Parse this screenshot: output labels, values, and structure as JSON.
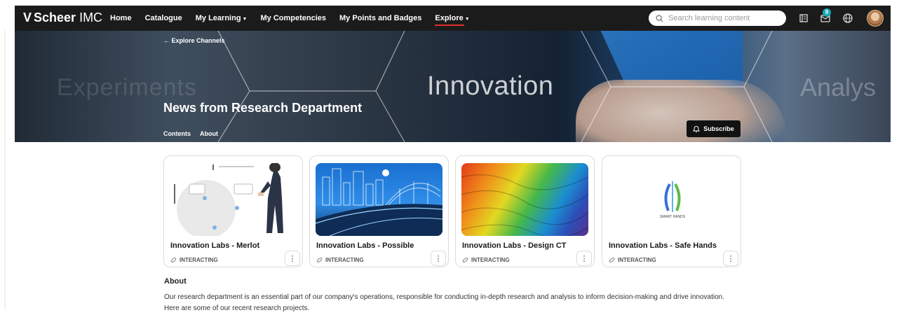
{
  "app": {
    "logo_mark": "V",
    "brand_bold": "Scheer",
    "brand_rest": " IMC"
  },
  "nav": [
    {
      "label": "Home",
      "has_caret": false,
      "active": false
    },
    {
      "label": "Catalogue",
      "has_caret": false,
      "active": false
    },
    {
      "label": "My Learning",
      "has_caret": true,
      "active": false
    },
    {
      "label": "My Competencies",
      "has_caret": false,
      "active": false
    },
    {
      "label": "My Points and Badges",
      "has_caret": false,
      "active": false
    },
    {
      "label": "Explore",
      "has_caret": true,
      "active": true
    }
  ],
  "search": {
    "placeholder": "Search learning content",
    "value": ""
  },
  "toolbar": {
    "message_count": "9",
    "icons": [
      "bookmark-icon",
      "mail-icon",
      "globe-icon",
      "avatar"
    ]
  },
  "banner": {
    "back_link": "← Explore Channels",
    "bg_word_left": "Experiments",
    "bg_word_center": "Innovation",
    "bg_word_right": "Analys",
    "title": "News from Research Department",
    "tabs": [
      "Contents",
      "About"
    ],
    "subscribe_label": "Subscribe"
  },
  "cards": [
    {
      "title": "Innovation Labs - Merlot",
      "type": "INTERACTING",
      "thumb": "illustration"
    },
    {
      "title": "Innovation Labs - Possible",
      "type": "INTERACTING",
      "thumb": "city-bridge"
    },
    {
      "title": "Innovation Labs - Design CT",
      "type": "INTERACTING",
      "thumb": "rainbow-texture"
    },
    {
      "title": "Innovation Labs - Safe Hands",
      "type": "INTERACTING",
      "thumb": "smart-hands-logo",
      "logo_text": "SMART HANDS"
    }
  ],
  "about": {
    "heading": "About",
    "text": "Our research department is an essential part of our company's operations, responsible for conducting in-depth research and analysis to inform decision-making and drive innovation. Here are some of our recent research projects."
  },
  "colors": {
    "nav_bg": "#1b1b1b",
    "active_underline": "#e0302d",
    "badge": "#18a7b5"
  }
}
